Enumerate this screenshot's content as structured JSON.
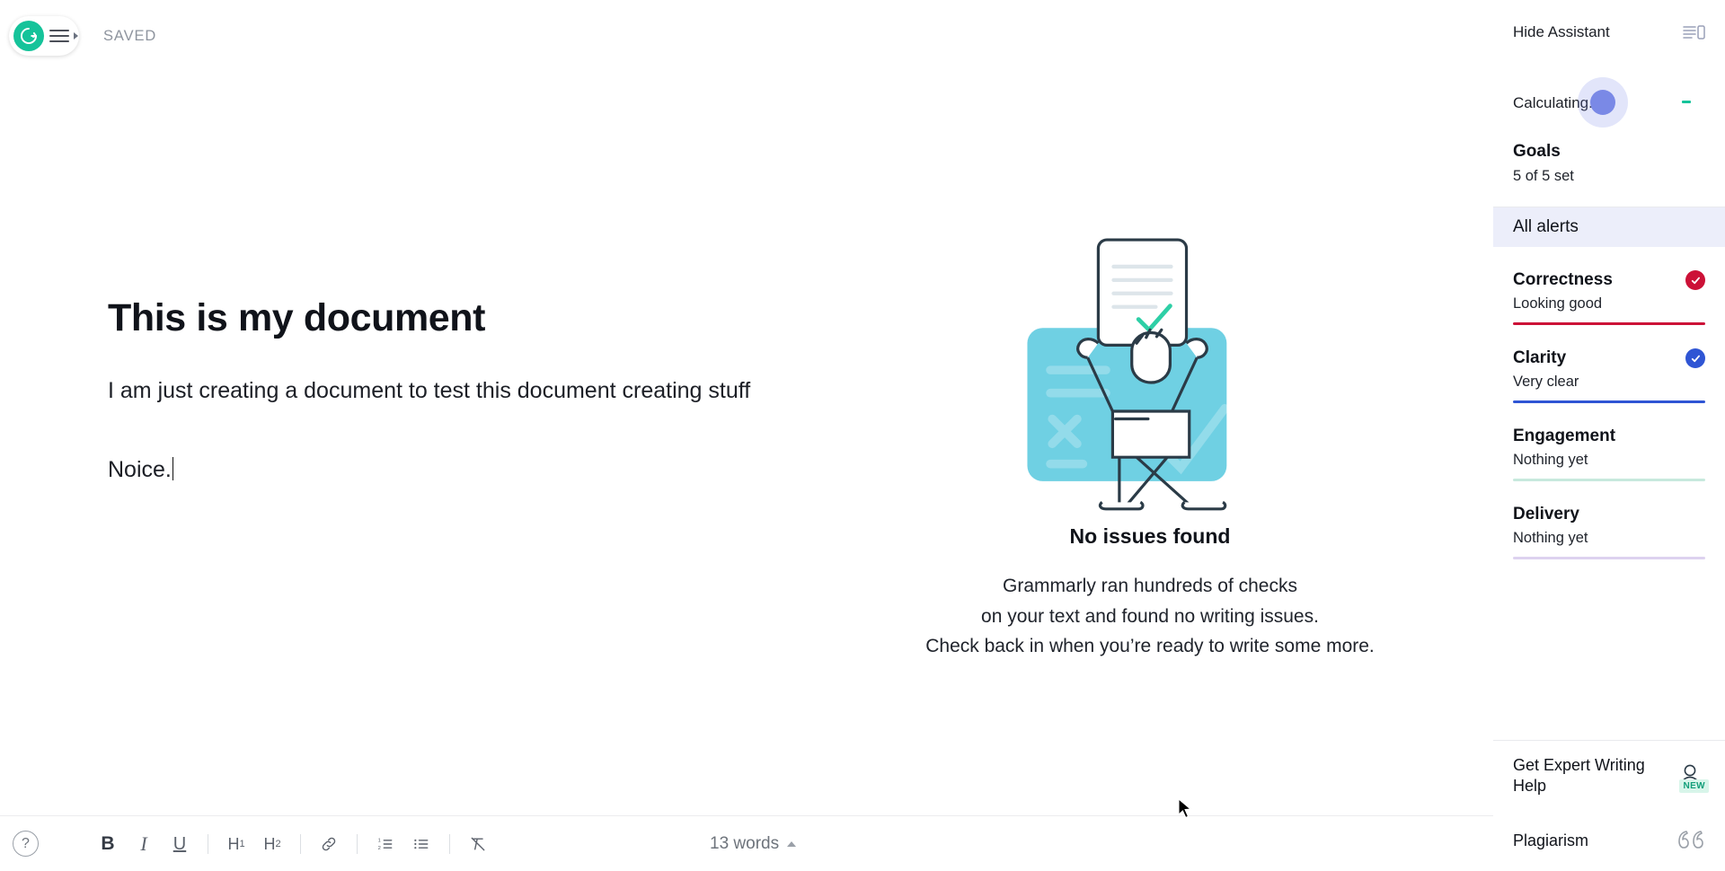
{
  "app": {
    "logo_icon": "grammarly-g-logo",
    "menu_icon": "hamburger-menu-icon",
    "saved_status": "SAVED"
  },
  "document": {
    "title": "This is my document",
    "paragraphs": [
      "I am just creating a document to test this document creating stuff",
      "Noice."
    ]
  },
  "empty_state": {
    "illustration": "person-holding-checked-document-illustration",
    "title": "No issues found",
    "lines": [
      "Grammarly ran hundreds of checks",
      "on your text and found no writing issues.",
      "Check back in when you’re ready to write some more."
    ]
  },
  "toolbar": {
    "help_label": "?",
    "help_icon": "question-mark-icon",
    "tools": [
      {
        "name": "bold-button",
        "label": "B",
        "icon": "bold-icon"
      },
      {
        "name": "italic-button",
        "label": "I",
        "icon": "italic-icon"
      },
      {
        "name": "underline-button",
        "label": "U",
        "icon": "underline-icon"
      },
      {
        "name": "heading-1-button",
        "label": "H",
        "sub": "1",
        "icon": "heading-1-icon"
      },
      {
        "name": "heading-2-button",
        "label": "H",
        "sub": "2",
        "icon": "heading-2-icon"
      },
      {
        "name": "link-button",
        "label": "",
        "icon": "link-icon"
      },
      {
        "name": "numbered-list-button",
        "label": "",
        "icon": "numbered-list-icon"
      },
      {
        "name": "bullet-list-button",
        "label": "",
        "icon": "bullet-list-icon"
      },
      {
        "name": "clear-formatting-button",
        "label": "",
        "icon": "clear-formatting-icon"
      }
    ],
    "word_count": "13 words",
    "word_count_caret_icon": "caret-up-icon"
  },
  "sidebar": {
    "hide_assistant_label": "Hide Assistant",
    "hide_assistant_icon": "hide-panel-icon",
    "score": {
      "status_label": "Calculating...",
      "value": "-",
      "spinner_icon": "loading-pulse-icon",
      "spinner_color": "#7a89e6",
      "dash_color": "#15c39a"
    },
    "goals": {
      "title": "Goals",
      "subtitle": "5 of 5 set"
    },
    "all_alerts_label": "All alerts",
    "all_alerts_bg": "#eceefa",
    "alerts": [
      {
        "name": "Correctness",
        "status": "Looking good",
        "color": "#cc1137",
        "has_check": true,
        "check_color": "#cc1137",
        "bar_filled": true,
        "icon": "check-circle-icon"
      },
      {
        "name": "Clarity",
        "status": "Very clear",
        "color": "#2f55d4",
        "has_check": true,
        "check_color": "#2f55d4",
        "bar_filled": true,
        "icon": "check-circle-icon"
      },
      {
        "name": "Engagement",
        "status": "Nothing yet",
        "color": "#c7e9dd",
        "has_check": false,
        "check_color": "",
        "bar_filled": false,
        "icon": ""
      },
      {
        "name": "Delivery",
        "status": "Nothing yet",
        "color": "#ddd2ef",
        "has_check": false,
        "check_color": "",
        "bar_filled": false,
        "icon": ""
      }
    ],
    "footer": [
      {
        "label": "Get Expert Writing Help",
        "icon": "person-icon",
        "badge": "NEW"
      },
      {
        "label": "Plagiarism",
        "icon": "quotation-marks-icon",
        "badge": ""
      }
    ]
  }
}
